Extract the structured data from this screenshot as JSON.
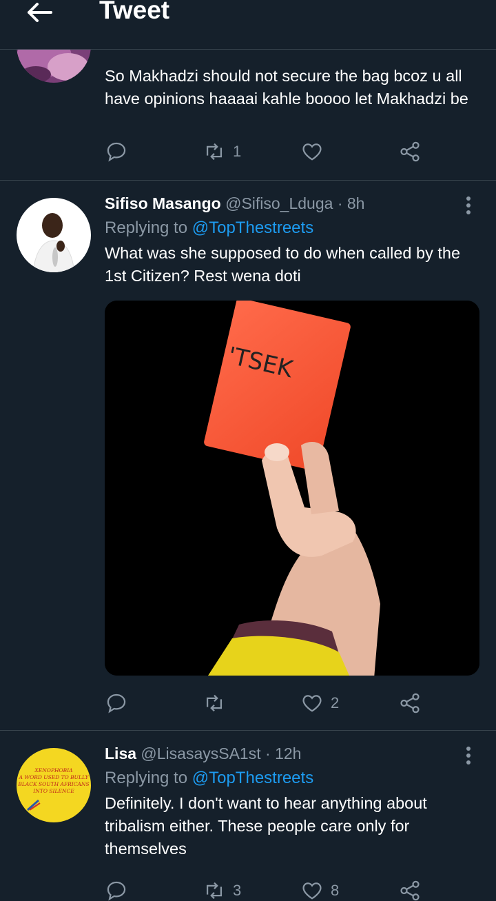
{
  "header": {
    "title": "Tweet"
  },
  "tweets": [
    {
      "text": "So Makhadzi should not secure the bag bcoz u all have opinions haaaai kahle boooo let Makhadzi be",
      "replies": "",
      "retweets": "1",
      "likes": ""
    },
    {
      "name": "Sifiso Masango",
      "handle": "@Sifiso_Lduga",
      "time": "· 8h",
      "replying_label": "Replying to",
      "replying_to": "@TopThestreets",
      "text": "What was she supposed to do when called by the 1st Citizen? Rest wena doti",
      "media_text": "'TSEK",
      "replies": "",
      "retweets": "",
      "likes": "2"
    },
    {
      "name": "Lisa",
      "handle": "@LisasaysSA1st",
      "time": "· 12h",
      "replying_label": "Replying to",
      "replying_to": "@TopThestreets",
      "text": "Definitely. I don't want to hear anything about tribalism either. These people care only for themselves",
      "avatar_text": [
        "XENOPHOBIA",
        "A WORD USED TO BULLY",
        "BLACK SOUTH AFRICANS",
        "INTO SILENCE"
      ],
      "replies": "",
      "retweets": "3",
      "likes": "8"
    }
  ],
  "colors": {
    "background": "#15202b",
    "accent": "#1d9bf0",
    "muted": "#8b98a5",
    "divider": "#38444d"
  }
}
